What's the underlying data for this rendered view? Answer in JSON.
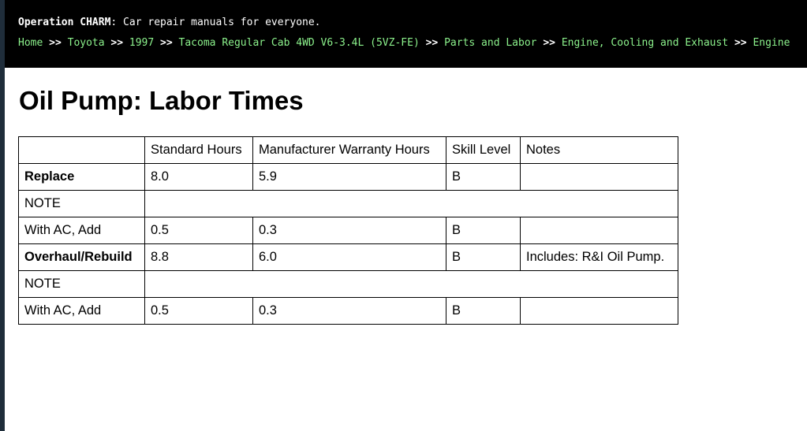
{
  "header": {
    "brand": "Operation CHARM",
    "tagline": ": Car repair manuals for everyone.",
    "separator": ">>",
    "breadcrumbs": [
      "Home",
      "Toyota",
      "1997",
      "Tacoma Regular Cab 4WD V6-3.4L (5VZ-FE)",
      "Parts and Labor",
      "Engine, Cooling and Exhaust",
      "Engine"
    ]
  },
  "page": {
    "title": "Oil Pump: Labor Times"
  },
  "table": {
    "columns": [
      "",
      "Standard Hours",
      "Manufacturer Warranty Hours",
      "Skill Level",
      "Notes"
    ],
    "rows": [
      {
        "op": "Replace",
        "standard": "8.0",
        "warranty": "5.9",
        "skill": "B",
        "notes": ""
      },
      {
        "note": "NOTE"
      },
      {
        "op": "With AC, Add",
        "standard": "0.5",
        "warranty": "0.3",
        "skill": "B",
        "notes": ""
      },
      {
        "op": "Overhaul/Rebuild",
        "standard": "8.8",
        "warranty": "6.0",
        "skill": "B",
        "notes": "Includes: R&I Oil Pump."
      },
      {
        "note": "NOTE"
      },
      {
        "op": "With AC, Add",
        "standard": "0.5",
        "warranty": "0.3",
        "skill": "B",
        "notes": ""
      }
    ]
  }
}
